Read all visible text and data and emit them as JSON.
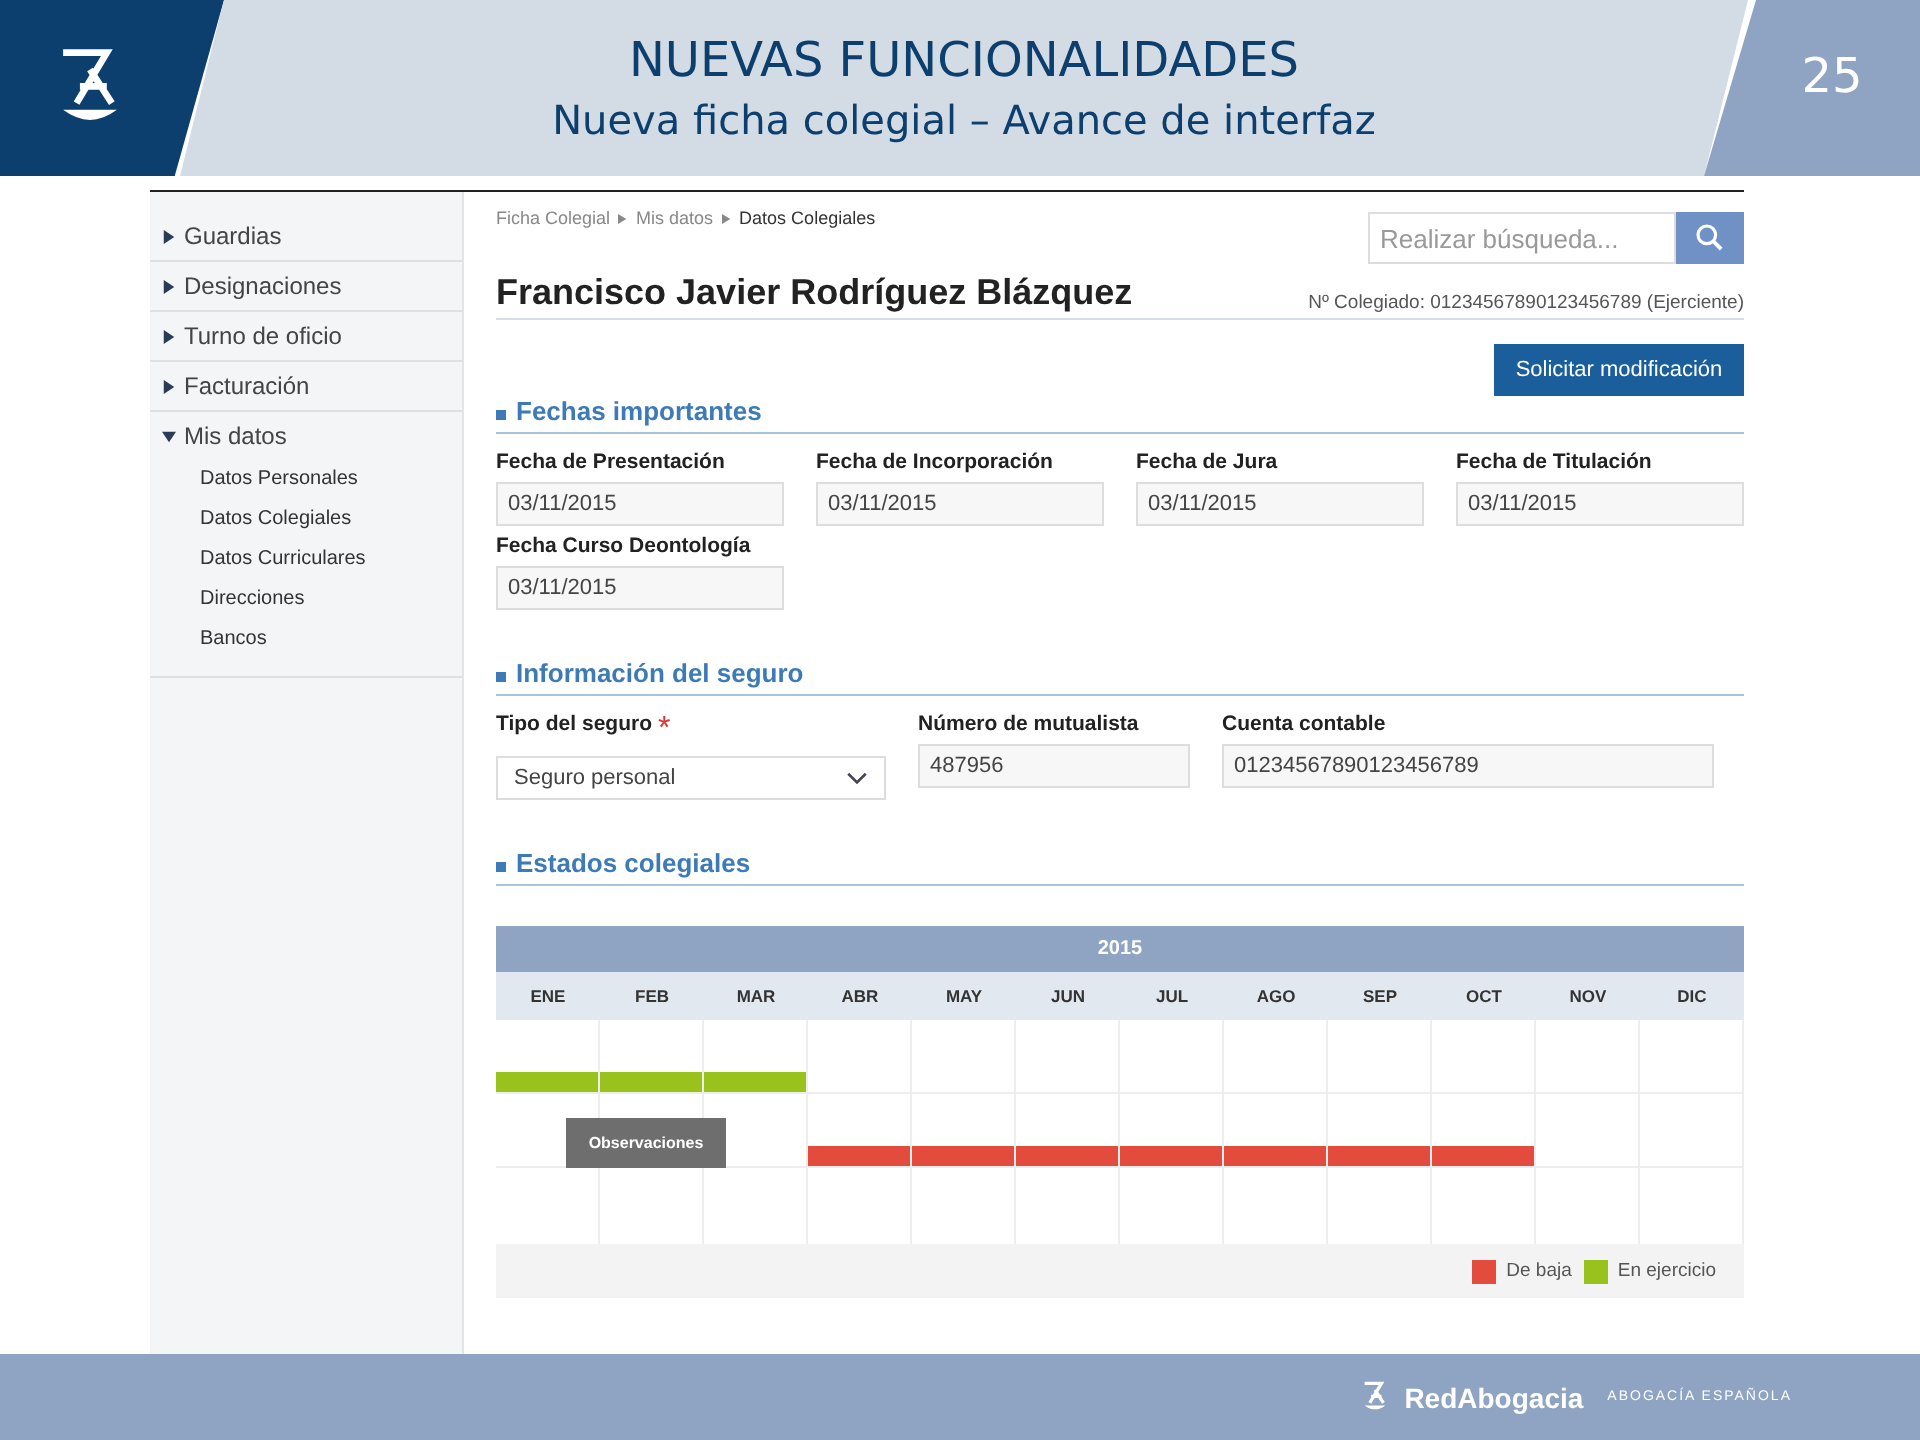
{
  "slide": {
    "title": "NUEVAS FUNCIONALIDADES",
    "subtitle": "Nueva ficha colegial – Avance de interfaz",
    "page_number": "25"
  },
  "sidebar": {
    "items": [
      {
        "label": "Guardias",
        "expanded": false
      },
      {
        "label": "Designaciones",
        "expanded": false
      },
      {
        "label": "Turno de oficio",
        "expanded": false
      },
      {
        "label": "Facturación",
        "expanded": false
      },
      {
        "label": "Mis datos",
        "expanded": true,
        "children": [
          {
            "label": "Datos Personales"
          },
          {
            "label": "Datos Colegiales"
          },
          {
            "label": "Datos Curriculares"
          },
          {
            "label": "Direcciones"
          },
          {
            "label": "Bancos"
          }
        ]
      }
    ]
  },
  "breadcrumb": [
    {
      "label": "Ficha Colegial",
      "current": false
    },
    {
      "label": "Mis datos",
      "current": false
    },
    {
      "label": "Datos Colegiales",
      "current": true
    }
  ],
  "search": {
    "placeholder": "Realizar búsqueda..."
  },
  "person": {
    "name": "Francisco Javier Rodríguez Blázquez",
    "member_number": "Nº Colegiado: 01234567890123456789 (Ejerciente)"
  },
  "request_button": "Solicitar modificación",
  "sections": [
    {
      "title": "Fechas importantes",
      "fields": [
        {
          "kind": "text",
          "label": "Fecha de Presentación",
          "value": "03/11/2015"
        },
        {
          "kind": "text",
          "label": "Fecha de Incorporación",
          "value": "03/11/2015"
        },
        {
          "kind": "text",
          "label": "Fecha de Jura",
          "value": "03/11/2015"
        },
        {
          "kind": "text",
          "label": "Fecha de Titulación",
          "value": "03/11/2015"
        },
        {
          "kind": "text",
          "label": "Fecha Curso Deontología",
          "value": "03/11/2015"
        }
      ]
    },
    {
      "title": "Información del seguro",
      "fields": [
        {
          "kind": "select",
          "label": "Tipo del seguro",
          "value": "Seguro personal",
          "required_mark": "*"
        },
        {
          "kind": "text",
          "label": "Número de mutualista",
          "value": "487956"
        },
        {
          "kind": "text",
          "label": "Cuenta contable",
          "value": "01234567890123456789"
        }
      ]
    },
    {
      "title": "Estados colegiales"
    }
  ],
  "timeline": {
    "year": "2015",
    "months": [
      "ENE",
      "FEB",
      "MAR",
      "ABR",
      "MAY",
      "JUN",
      "JUL",
      "AGO",
      "SEP",
      "OCT",
      "NOV",
      "DIC"
    ],
    "bars": [
      {
        "color": "#99c21c",
        "months": [
          true,
          true,
          true,
          false,
          false,
          false,
          false,
          false,
          false,
          false,
          false,
          false
        ]
      },
      {
        "color": "#e34b3d",
        "months": [
          false,
          false,
          false,
          true,
          true,
          true,
          true,
          true,
          true,
          true,
          false,
          false
        ]
      }
    ],
    "tooltip": "Observaciones",
    "legend": [
      {
        "label": "De baja",
        "color": "#e34b3d"
      },
      {
        "label": "En ejercicio",
        "color": "#99c21c"
      }
    ]
  },
  "footer": {
    "brand": "RedAbogacia",
    "tagline": "ABOGACÍA ESPAÑOLA"
  }
}
